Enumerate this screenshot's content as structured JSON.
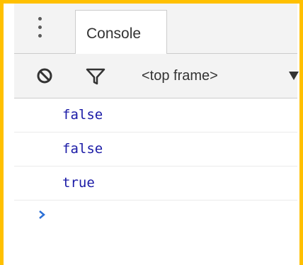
{
  "tab": {
    "label": "Console",
    "menu_icon": "vertical-ellipsis-icon"
  },
  "toolbar": {
    "clear_icon": "clear-console-icon",
    "filter_icon": "filter-icon",
    "context_label": "<top frame>",
    "dropdown_icon": "triangle-down-icon"
  },
  "console": {
    "lines": [
      "false",
      "false",
      "true"
    ],
    "prompt_icon": "chevron-right-icon"
  },
  "colors": {
    "frame": "#ffc000",
    "value_text": "#1a1aa6",
    "prompt": "#2b6fd6"
  }
}
